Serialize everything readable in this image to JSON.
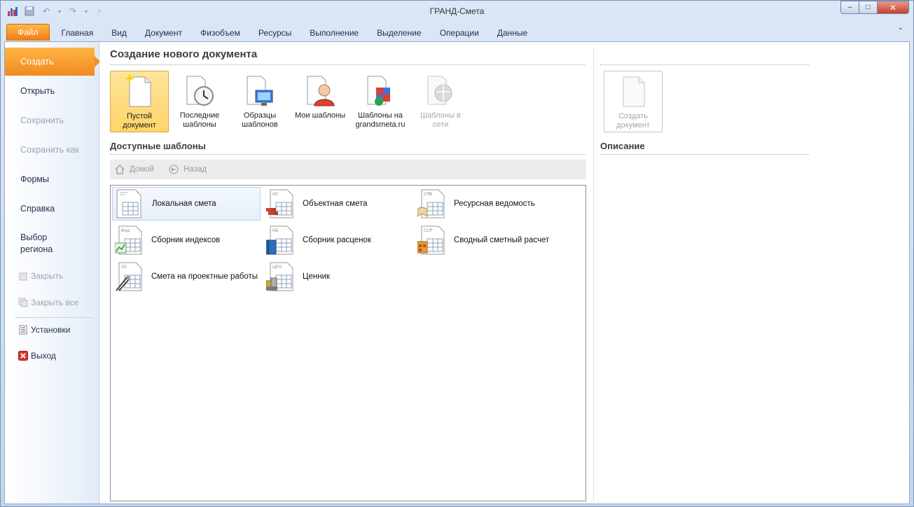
{
  "window": {
    "title": "ГРАНД-Смета",
    "controls": {
      "minimize": "–",
      "maximize": "□",
      "close": "✕"
    }
  },
  "ribbon": {
    "tabs": [
      "Файл",
      "Главная",
      "Вид",
      "Документ",
      "Физобъем",
      "Ресурсы",
      "Выполнение",
      "Выделение",
      "Операции",
      "Данные"
    ],
    "collapse": "⌃"
  },
  "nav": {
    "create": "Создать",
    "open": "Открыть",
    "save": "Сохранить",
    "save_as": "Сохранить как",
    "forms": "Формы",
    "help": "Справка",
    "region_line1": "Выбор",
    "region_line2": "региона",
    "close": "Закрыть",
    "close_all": "Закрыть все",
    "settings": "Установки",
    "exit": "Выход"
  },
  "create_section": {
    "title": "Создание нового документа",
    "tiles": [
      {
        "line1": "Пустой",
        "line2": "документ"
      },
      {
        "line1": "Последние",
        "line2": "шаблоны"
      },
      {
        "line1": "Образцы",
        "line2": "шаблонов"
      },
      {
        "line1": "Мои шаблоны",
        "line2": ""
      },
      {
        "line1": "Шаблоны на",
        "line2": "grandsmeta.ru"
      },
      {
        "line1": "Шаблоны в",
        "line2": "сети"
      }
    ]
  },
  "available": {
    "title": "Доступные шаблоны",
    "home": "Домой",
    "back": "Назад",
    "items": [
      {
        "label": "Локальная смета",
        "code": ""
      },
      {
        "label": "Объектная смета",
        "code": "ОС"
      },
      {
        "label": "Ресурсная ведомость",
        "code": "СРВ"
      },
      {
        "label": "Сборник индексов",
        "code": "Инд"
      },
      {
        "label": "Сборник расценок",
        "code": "НБ"
      },
      {
        "label": "Сводный сметный расчет",
        "code": "ССР"
      },
      {
        "label": "Смета на проектные работы",
        "code": "ПС"
      },
      {
        "label": "Ценник",
        "code": "ЦЕН"
      }
    ]
  },
  "right": {
    "create_line1": "Создать",
    "create_line2": "документ",
    "description_title": "Описание"
  },
  "colors": {
    "accent": "#f08a1d",
    "selected_tile": "#ffd46a"
  }
}
